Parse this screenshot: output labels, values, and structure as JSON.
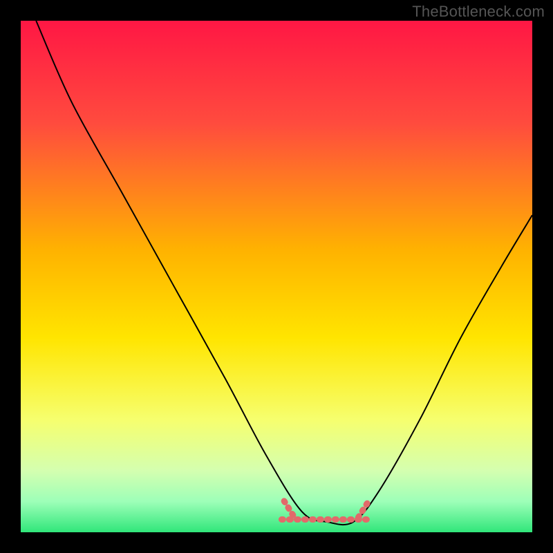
{
  "watermark": "TheBottleneck.com",
  "chart_data": {
    "type": "line",
    "title": "",
    "xlabel": "",
    "ylabel": "",
    "xlim": [
      0,
      100
    ],
    "ylim": [
      0,
      100
    ],
    "gradient_stops": [
      {
        "offset": 0,
        "color": "#ff1744"
      },
      {
        "offset": 0.2,
        "color": "#ff4b3e"
      },
      {
        "offset": 0.45,
        "color": "#ffb300"
      },
      {
        "offset": 0.62,
        "color": "#ffe500"
      },
      {
        "offset": 0.78,
        "color": "#f6ff6e"
      },
      {
        "offset": 0.88,
        "color": "#d4ffb0"
      },
      {
        "offset": 0.94,
        "color": "#9dffb8"
      },
      {
        "offset": 1.0,
        "color": "#30e67a"
      }
    ],
    "series": [
      {
        "name": "bottleneck-curve",
        "x": [
          3,
          10,
          20,
          30,
          40,
          48,
          55,
          60,
          65,
          70,
          78,
          86,
          94,
          100
        ],
        "y": [
          100,
          84,
          66,
          48,
          30,
          15,
          4,
          2,
          2,
          8,
          22,
          38,
          52,
          62
        ]
      }
    ],
    "flat_band": {
      "x_start": 51,
      "x_end": 68,
      "y": 2.5
    },
    "transition_markers": [
      {
        "x_center": 52.5,
        "y_center": 4.5,
        "angle_deg": -58
      },
      {
        "x_center": 67.0,
        "y_center": 4.5,
        "angle_deg": 58
      }
    ]
  }
}
